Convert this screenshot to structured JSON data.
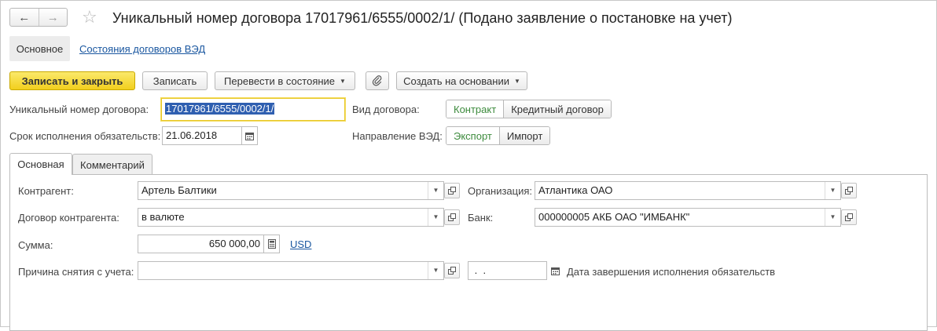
{
  "window": {
    "title": "Уникальный номер договора 17017961/6555/0002/1/  (Подано заявление о постановке на учет)"
  },
  "nav": {
    "back_icon": "arrow-left-icon",
    "forward_icon": "arrow-right-icon",
    "favorite_icon": "star-icon"
  },
  "sections": {
    "main_label": "Основное",
    "states_link": "Состояния договоров ВЭД"
  },
  "toolbar": {
    "save_close_label": "Записать и закрыть",
    "save_label": "Записать",
    "change_state_label": "Перевести в состояние",
    "attach_icon": "paperclip-icon",
    "create_based_label": "Создать на основании"
  },
  "header": {
    "contract_number_label": "Уникальный номер договора:",
    "contract_number_value": "17017961/6555/0002/1/",
    "due_date_label": "Срок исполнения обязательств:",
    "due_date_value": "21.06.2018",
    "contract_type_label": "Вид договора:",
    "contract_type_options": [
      "Контракт",
      "Кредитный договор"
    ],
    "contract_type_selected": "Контракт",
    "direction_label": "Направление ВЭД:",
    "direction_options": [
      "Экспорт",
      "Импорт"
    ],
    "direction_selected": "Экспорт"
  },
  "tabs": [
    {
      "label": "Основная",
      "active": true
    },
    {
      "label": "Комментарий",
      "active": false
    }
  ],
  "main_tab": {
    "counterparty_label": "Контрагент:",
    "counterparty_value": "Артель Балтики",
    "counterparty_contract_label": "Договор контрагента:",
    "counterparty_contract_value": "в валюте",
    "amount_label": "Сумма:",
    "amount_value": "650 000,00",
    "currency_link": "USD",
    "removal_reason_label": "Причина снятия с учета:",
    "removal_reason_value": "",
    "organization_label": "Организация:",
    "organization_value": "Атлантика ОАО",
    "bank_label": "Банк:",
    "bank_value": "000000005 АКБ ОАО \"ИМБАНК\"",
    "completion_date_value": " .  .",
    "completion_date_label": "Дата завершения исполнения обязательств"
  },
  "colors": {
    "primary_button": "#f5d327",
    "link": "#1a57a0",
    "selected_segment_text": "#3d8b3d",
    "focus_border": "#e8c82a",
    "selection_bg": "#2f5fb0"
  }
}
